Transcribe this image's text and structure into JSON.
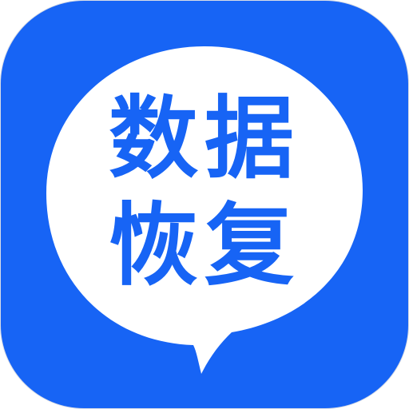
{
  "app_icon": {
    "line1": "数据",
    "line2": "恢复",
    "colors": {
      "background": "#1764f5",
      "bubble": "#ffffff",
      "text": "#1764f5"
    },
    "icon_name": "speech-bubble-icon"
  }
}
